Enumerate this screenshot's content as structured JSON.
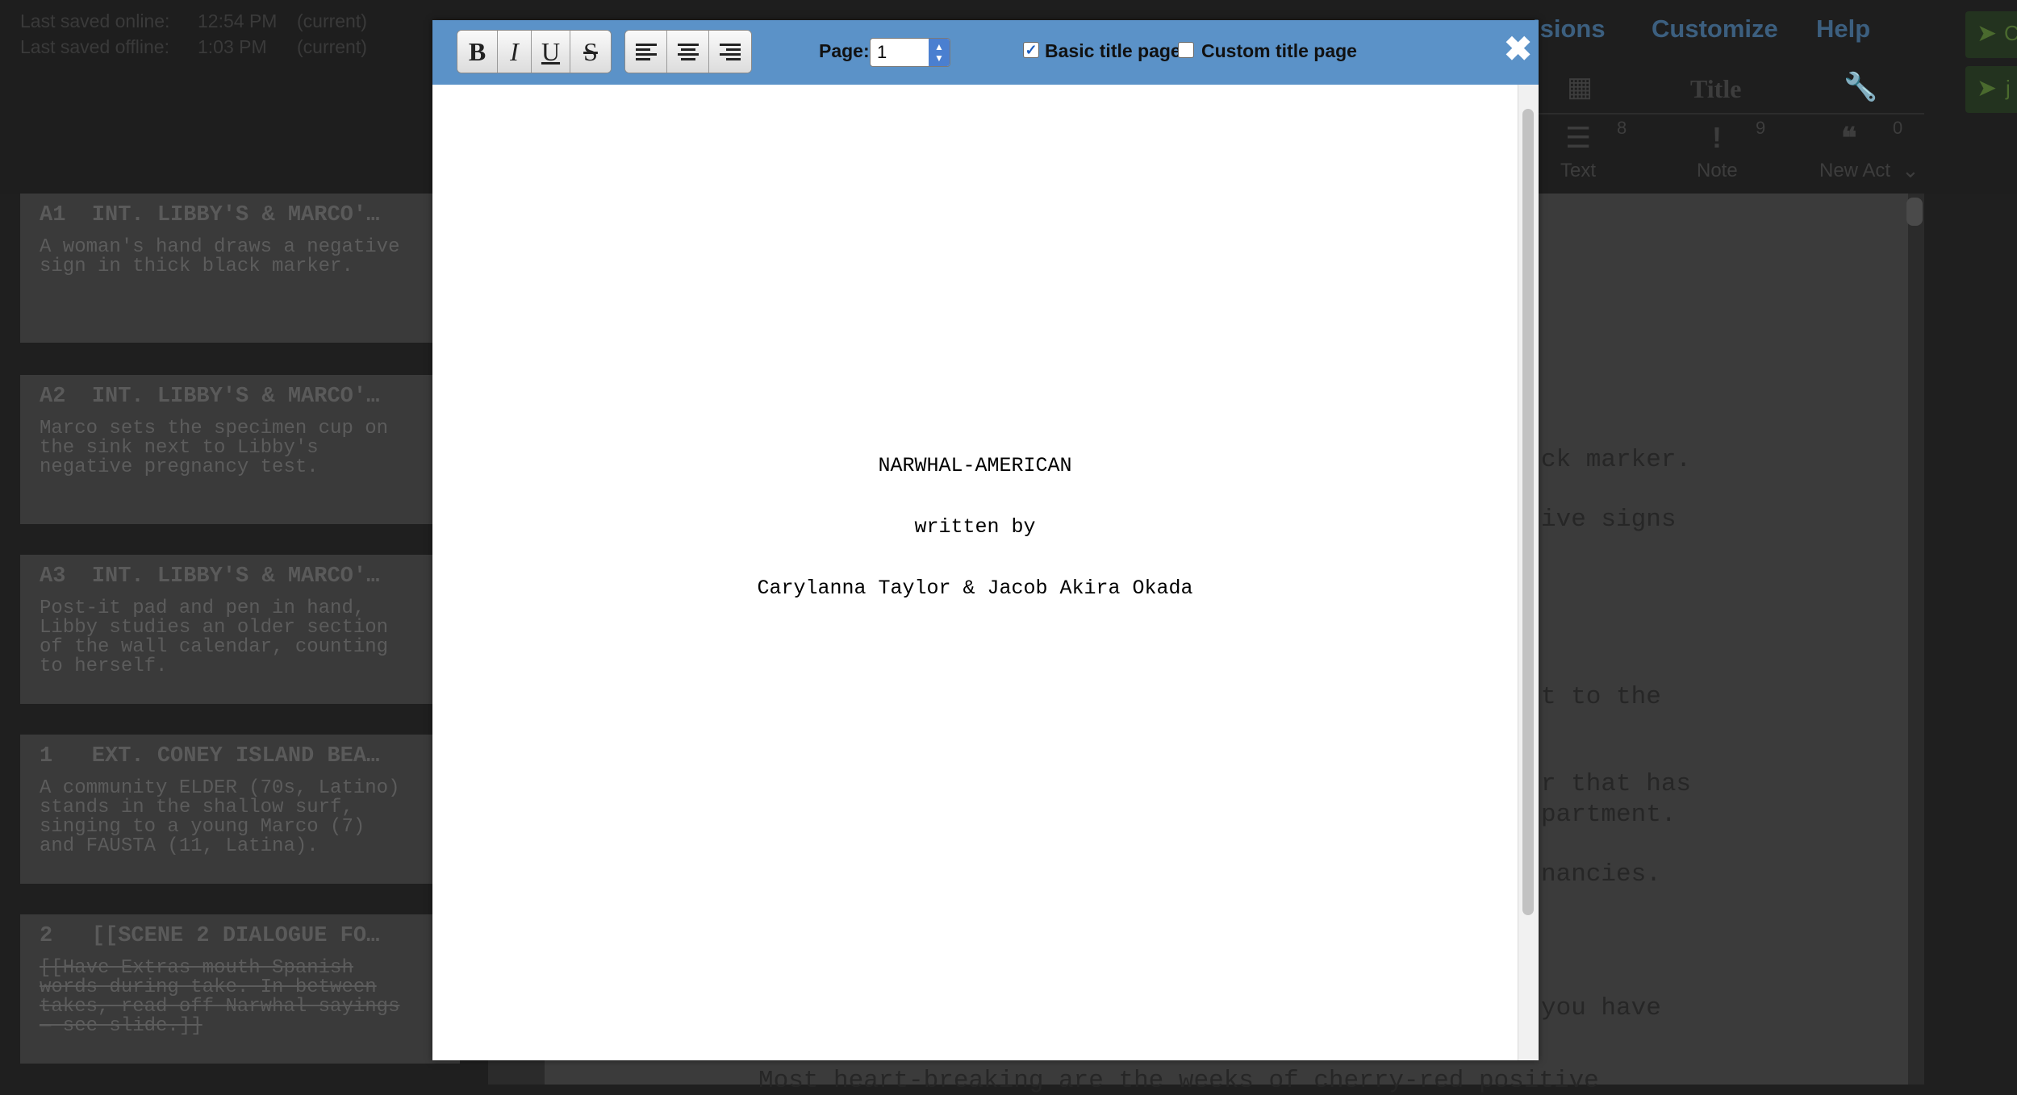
{
  "saved": {
    "online_label": "Last saved online:",
    "online_time": "12:54 PM",
    "online_status": "(current)",
    "offline_label": "Last saved offline:",
    "offline_time": "1:03 PM",
    "offline_status": "(current)"
  },
  "menu": {
    "revisions": "isions",
    "customize": "Customize",
    "help": "Help"
  },
  "side_buttons": {
    "one": "C",
    "two": "j"
  },
  "toolbar_bg": {
    "title": "Title",
    "text_label": "Text",
    "text_count": "8",
    "note_label": "Note",
    "note_count": "9",
    "new_act_label": "New Act",
    "new_act_count": "0"
  },
  "cards": [
    {
      "heading": "A1  INT. LIBBY'S & MARCO'…",
      "body": "A woman's hand draws a negative\nsign in thick black marker.",
      "struck": false
    },
    {
      "heading": "A2  INT. LIBBY'S & MARCO'…",
      "body": "Marco sets the specimen cup on\nthe sink next to Libby's\nnegative pregnancy test.",
      "struck": false
    },
    {
      "heading": "A3  INT. LIBBY'S & MARCO'…",
      "body": "Post-it pad and pen in hand,\nLibby studies an older section\nof the wall calendar, counting\nto herself.",
      "struck": false
    },
    {
      "heading": "1   EXT. CONEY ISLAND BEA…",
      "body": "A community ELDER (70s, Latino)\nstands in the shallow surf,\nsinging to a young Marco (7)\nand FAUSTA (11, Latina).",
      "struck": false
    },
    {
      "heading": "2   [[SCENE 2 DIALOGUE FO…",
      "body": "[[Have Extras mouth Spanish\nwords during take. In between\ntakes, read off Narwhal sayings\n— see slide.]]",
      "struck": true
    }
  ],
  "script_fragments": [
    "ck marker.",
    "ive signs",
    "t to the",
    "r that has",
    "partment.",
    "nancies.",
    "you have",
    "Most heart-breaking are the weeks of cherry-red positive"
  ],
  "modal": {
    "buttons": {
      "bold": "B",
      "italic": "I",
      "underline": "U",
      "strike": "S"
    },
    "page_label": "Page:",
    "page_value": "1",
    "basic_title_label": "Basic title page",
    "basic_title_checked": true,
    "custom_title_label": "Custom title page",
    "custom_title_checked": false,
    "close_symbol": "✖"
  },
  "title_page": {
    "title": "NARWHAL-AMERICAN",
    "written_by": "written by",
    "authors": "Carylanna Taylor & Jacob Akira Okada"
  },
  "colors": {
    "modal_header": "#5b92c8",
    "spinner": "#4a7fd0"
  }
}
